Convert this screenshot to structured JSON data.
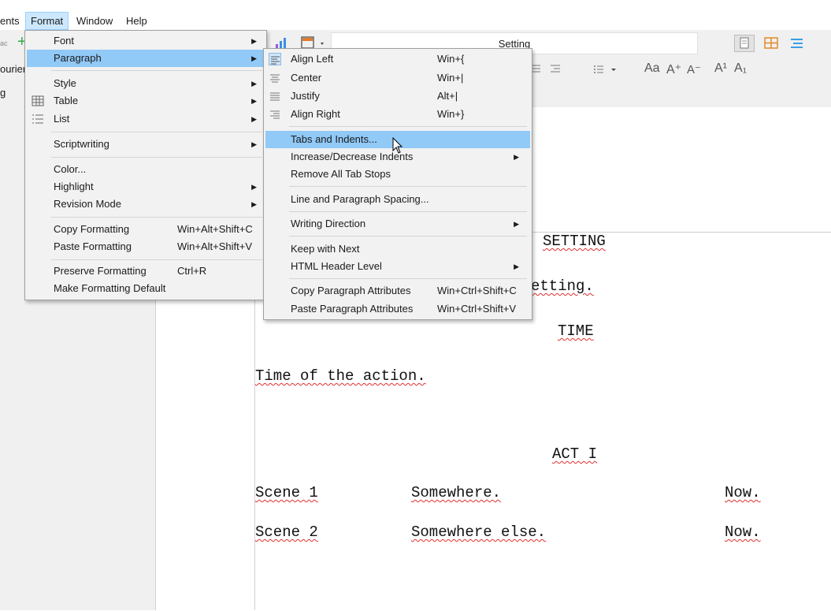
{
  "menubar": {
    "items": [
      {
        "label": "ents"
      },
      {
        "label": "Format"
      },
      {
        "label": "Window"
      },
      {
        "label": "Help"
      }
    ]
  },
  "toolbar": {
    "left_fragment": "ac",
    "setting_field": "Setting",
    "font_fragment": "ourier",
    "row3_fragment": "g"
  },
  "format_menu": {
    "items": [
      {
        "label": "Font",
        "submenu": true
      },
      {
        "label": "Paragraph",
        "submenu": true
      },
      {
        "label": "Style",
        "submenu": true
      },
      {
        "label": "Table",
        "submenu": true
      },
      {
        "label": "List",
        "submenu": true
      },
      {
        "label": "Scriptwriting",
        "submenu": true
      },
      {
        "label": "Color..."
      },
      {
        "label": "Highlight",
        "submenu": true
      },
      {
        "label": "Revision Mode",
        "submenu": true
      },
      {
        "label": "Copy Formatting",
        "shortcut": "Win+Alt+Shift+C"
      },
      {
        "label": "Paste Formatting",
        "shortcut": "Win+Alt+Shift+V"
      },
      {
        "label": "Preserve Formatting",
        "shortcut": "Ctrl+R"
      },
      {
        "label": "Make Formatting Default"
      }
    ]
  },
  "paragraph_menu": {
    "items": [
      {
        "label": "Align Left",
        "shortcut": "Win+{"
      },
      {
        "label": "Center",
        "shortcut": "Win+|"
      },
      {
        "label": "Justify",
        "shortcut": "Alt+|"
      },
      {
        "label": "Align Right",
        "shortcut": "Win+}"
      },
      {
        "label": "Tabs and Indents..."
      },
      {
        "label": "Increase/Decrease Indents",
        "submenu": true
      },
      {
        "label": "Remove All Tab Stops"
      },
      {
        "label": "Line and Paragraph Spacing..."
      },
      {
        "label": "Writing Direction",
        "submenu": true
      },
      {
        "label": "Keep with Next"
      },
      {
        "label": "HTML Header Level",
        "submenu": true
      },
      {
        "label": "Copy Paragraph Attributes",
        "shortcut": "Win+Ctrl+Shift+C"
      },
      {
        "label": "Paste Paragraph Attributes",
        "shortcut": "Win+Ctrl+Shift+V"
      }
    ]
  },
  "editor": {
    "heading_setting": "SETTING",
    "setting_text_fragment": "etting.",
    "heading_time": "TIME",
    "time_text": "Time of the action.",
    "heading_act": "ACT I",
    "scenes": [
      {
        "scene": "Scene 1",
        "place": "Somewhere.",
        "time": "Now."
      },
      {
        "scene": "Scene 2",
        "place": "Somewhere else.",
        "time": "Now."
      }
    ]
  },
  "icons": {
    "submenu_arrow": "▶",
    "dropdown": "▾"
  },
  "colors": {
    "highlight": "#91c9f7",
    "menubar_active": "#cce8ff",
    "spellcheck": "#e03030"
  }
}
